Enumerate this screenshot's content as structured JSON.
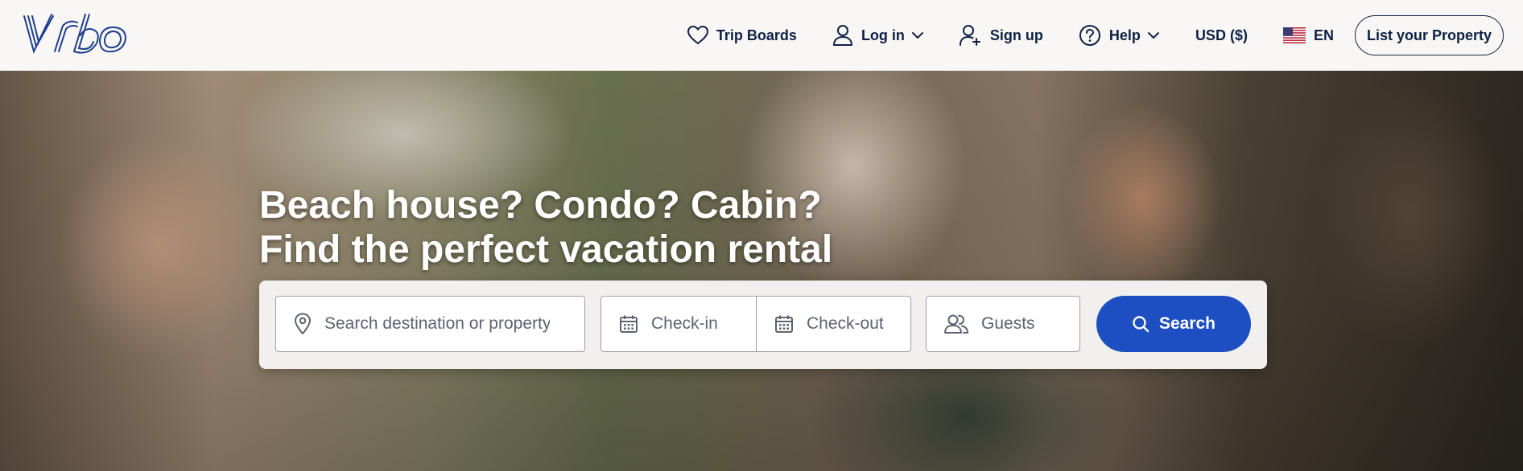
{
  "brand": {
    "logo_text": "Vrbo",
    "color": "#1c3d8f"
  },
  "nav": {
    "trip_boards": "Trip Boards",
    "log_in": "Log in",
    "sign_up": "Sign up",
    "help": "Help",
    "currency": "USD ($)",
    "language": "EN",
    "list_property": "List your Property"
  },
  "hero": {
    "headline_line1": "Beach house? Condo? Cabin?",
    "headline_line2": "Find the perfect vacation rental"
  },
  "search": {
    "destination_placeholder": "Search destination or property ID",
    "checkin_label": "Check-in",
    "checkout_label": "Check-out",
    "guests_label": "Guests",
    "button_label": "Search",
    "button_color": "#1e4fc2"
  },
  "icons": {
    "trip_boards": "heart-icon",
    "log_in": "user-icon",
    "sign_up": "user-plus-icon",
    "help": "question-circle-icon",
    "language": "us-flag-icon",
    "destination": "map-pin-icon",
    "dates": "calendar-icon",
    "guests": "users-icon",
    "search": "search-icon"
  }
}
